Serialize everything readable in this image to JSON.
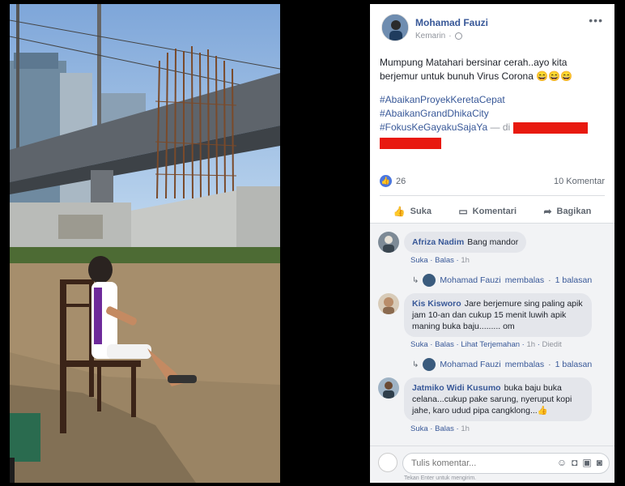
{
  "post": {
    "author": "Mohamad Fauzi",
    "time": "Kemarin",
    "more_icon": "more-dots-icon",
    "text": "Mumpung Matahari bersinar cerah..ayo kita berjemur untuk bunuh Virus Corona 😄😄😄",
    "hashtags": [
      "#AbaikanProyekKeretaCepat",
      "#AbaikanGrandDhikaCity",
      "#FokusKeGayakuSajaYa"
    ],
    "location_prefix": "— di",
    "redact_color": "#e8190f"
  },
  "stats": {
    "likes": "26",
    "comments": "10 Komentar"
  },
  "actions": {
    "like": "Suka",
    "comment": "Komentari",
    "share": "Bagikan"
  },
  "comments": [
    {
      "name": "Afriza Nadim",
      "text": "Bang mandor",
      "like": "Suka",
      "reply": "Balas",
      "time": "1h",
      "reply_summary": {
        "name": "Mohamad Fauzi",
        "action": "membalas",
        "count": "1 balasan"
      }
    },
    {
      "name": "Kis Kisworo",
      "text_lines": [
        "Jare berjemure sing paling apik",
        "jam 10-an dan cukup 15 menit luwih apik",
        "maning buka baju......... om"
      ],
      "like": "Suka",
      "reply": "Balas",
      "translate": "Lihat Terjemahan",
      "time": "1h",
      "edited": "Diedit",
      "reply_summary": {
        "name": "Mohamad Fauzi",
        "action": "membalas",
        "count": "1 balasan"
      }
    },
    {
      "name": "Jatmiko Widi Kusumo",
      "text_lines": [
        "buka baju buka",
        "celana...cukup pake sarung, nyeruput kopi",
        "jahe, karo udud pipa cangklong...👍"
      ],
      "like": "Suka",
      "reply": "Balas",
      "time": "1h"
    }
  ],
  "composer": {
    "placeholder": "Tulis komentar...",
    "hint": "Tekan Enter untuk mengirim."
  },
  "colors": {
    "link": "#385898",
    "like_blue": "#4b77e0"
  }
}
